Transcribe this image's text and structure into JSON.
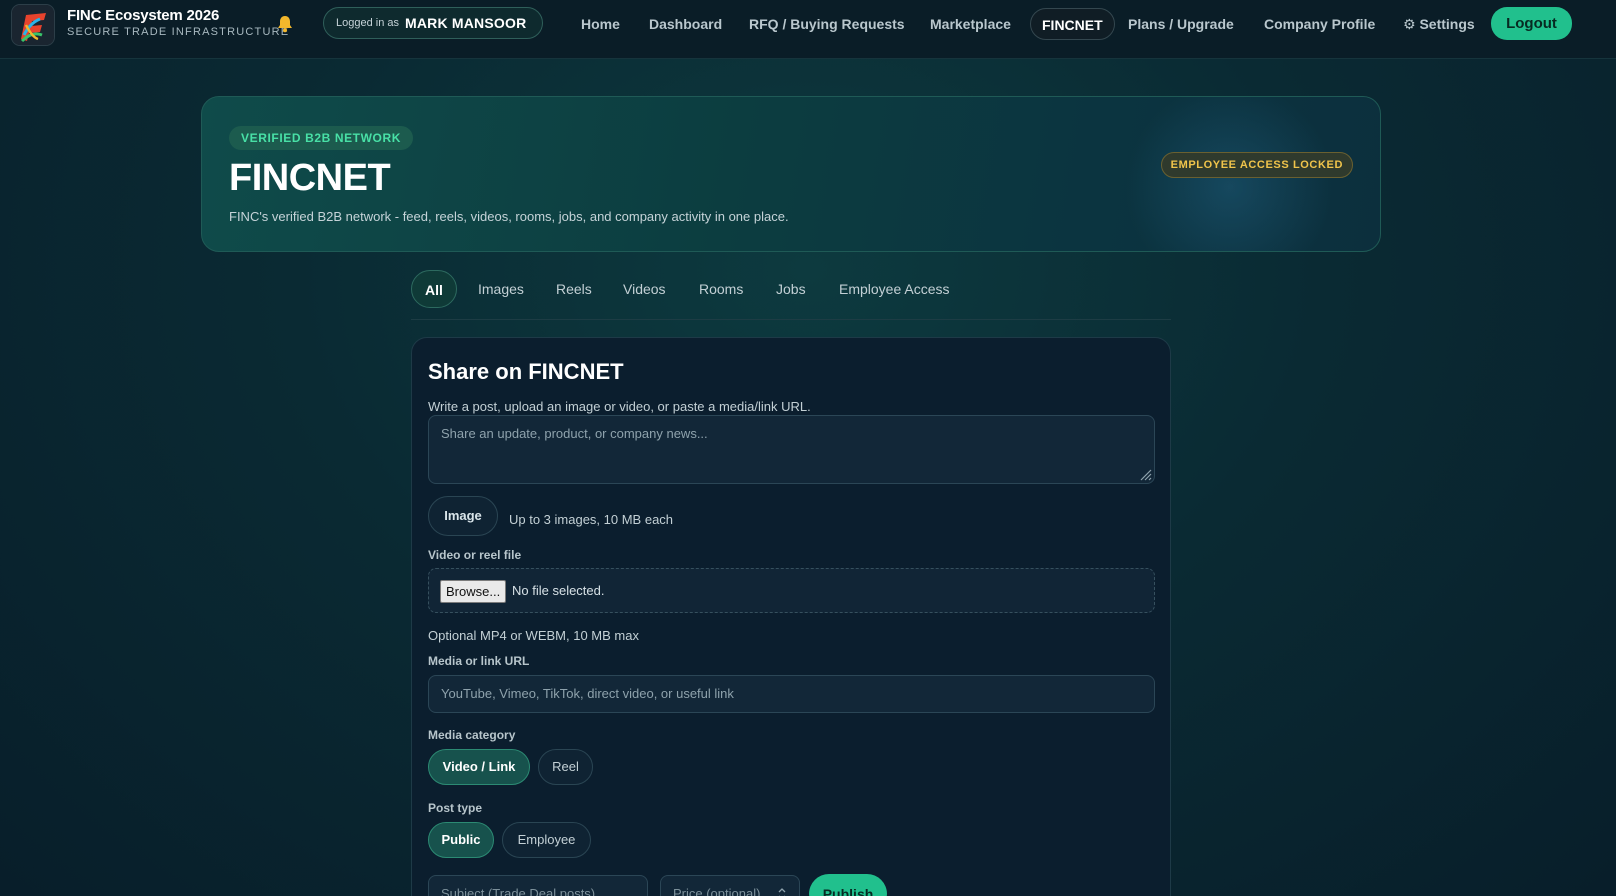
{
  "app": {
    "title": "FINC Ecosystem 2026",
    "subtitle": "SECURE TRADE INFRASTRUCTURE"
  },
  "user": {
    "logged_in_label": "Logged in as",
    "name": "MARK MANSOOR"
  },
  "nav": {
    "items": [
      {
        "label": "Home"
      },
      {
        "label": "Dashboard"
      },
      {
        "label": "RFQ / Buying Requests"
      },
      {
        "label": "Marketplace"
      },
      {
        "label": "FINCNET",
        "active": true
      },
      {
        "label": "Plans / Upgrade"
      },
      {
        "label": "Company Profile"
      },
      {
        "label": "⚙ Settings"
      }
    ],
    "logout_label": "Logout"
  },
  "hero": {
    "badge": "VERIFIED B2B NETWORK",
    "title": "FINCNET",
    "description": "FINC's verified B2B network - feed, reels, videos, rooms, jobs, and company activity in one place.",
    "access_badge": "EMPLOYEE ACCESS LOCKED"
  },
  "tabs": {
    "items": [
      {
        "label": "All",
        "active": true
      },
      {
        "label": "Images"
      },
      {
        "label": "Reels"
      },
      {
        "label": "Videos"
      },
      {
        "label": "Rooms"
      },
      {
        "label": "Jobs"
      },
      {
        "label": "Employee Access"
      }
    ]
  },
  "share": {
    "title": "Share on FINCNET",
    "subtitle": "Write a post, upload an image or video, or paste a media/link URL.",
    "post_placeholder": "Share an update, product, or company news...",
    "image_button": "Image",
    "image_hint": "Up to 3 images, 10 MB each",
    "video_label": "Video or reel file",
    "browse_button": "Browse...",
    "file_status": "No file selected.",
    "video_hint": "Optional MP4 or WEBM, 10 MB max",
    "url_label": "Media or link URL",
    "url_placeholder": "YouTube, Vimeo, TikTok, direct video, or useful link",
    "media_category_label": "Media category",
    "media_categories": [
      {
        "label": "Video / Link",
        "active": true
      },
      {
        "label": "Reel"
      }
    ],
    "post_type_label": "Post type",
    "post_types": [
      {
        "label": "Public",
        "active": true
      },
      {
        "label": "Employee"
      }
    ],
    "subject_placeholder": "Subject (Trade Deal posts)",
    "price_placeholder": "Price (optional)",
    "publish_button": "Publish"
  },
  "colors": {
    "accent": "#21c08d",
    "background": "#0a2a33",
    "card": "#0b1e2e",
    "warning": "#f0c44b"
  },
  "icons": {
    "logo": "finc-logo-icon",
    "notifications": "bell-icon",
    "settings": "gear-icon",
    "resize": "resize-grip-icon",
    "stepper": "stepper-arrows-icon"
  }
}
